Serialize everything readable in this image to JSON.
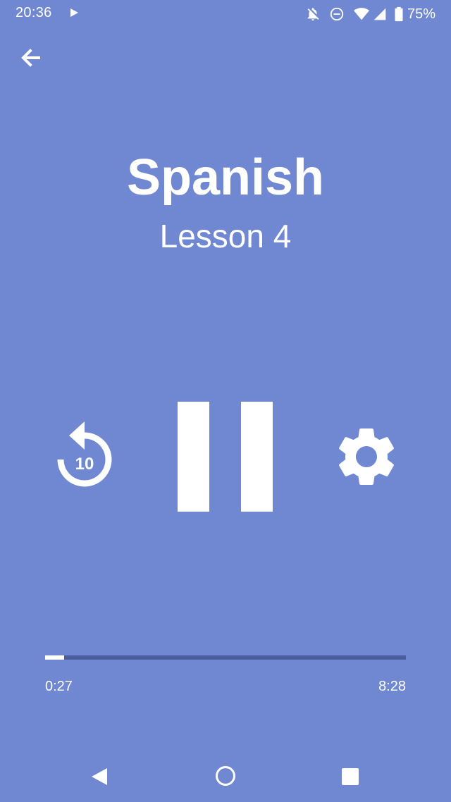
{
  "status_bar": {
    "time": "20:36",
    "battery_percent": "75%",
    "icons": [
      "play-icon",
      "notifications-off-icon",
      "do-not-disturb-icon",
      "wifi-icon",
      "cell-signal-icon",
      "battery-icon"
    ]
  },
  "header": {
    "back_icon": "arrow-left-icon"
  },
  "lesson": {
    "title": "Spanish",
    "subtitle": "Lesson 4"
  },
  "controls": {
    "replay_icon": "replay-10-icon",
    "replay_seconds": "10",
    "pause_icon": "pause-icon",
    "settings_icon": "gear-icon"
  },
  "progress": {
    "elapsed": "0:27",
    "total": "8:28",
    "fraction": 0.053
  },
  "nav_bar": {
    "icons": [
      "nav-back-icon",
      "nav-home-icon",
      "nav-recents-icon"
    ]
  },
  "colors": {
    "background": "#7087d2",
    "foreground": "#ffffff",
    "progress_track": "#4a5d9f"
  }
}
